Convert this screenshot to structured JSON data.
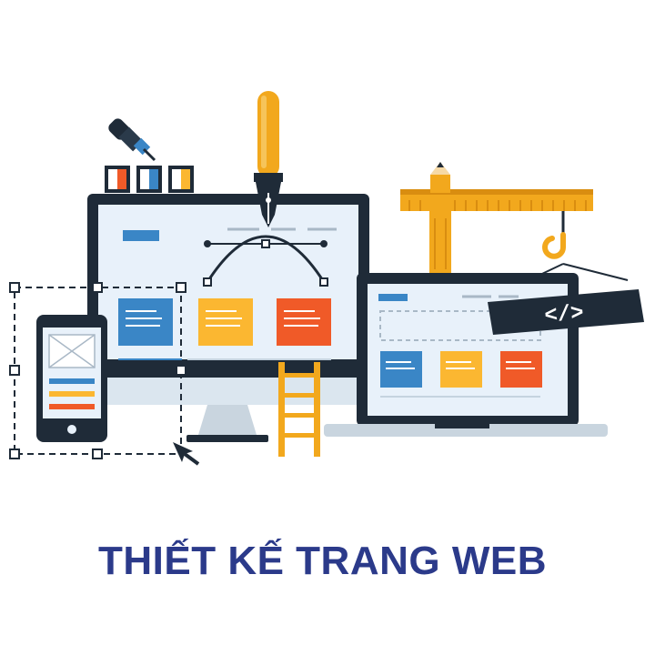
{
  "caption": "THIẾT KẾ TRANG WEB",
  "code_sign": "</>",
  "colors": {
    "navy": "#1f2b38",
    "screen": "#e8f1fa",
    "blue_card": "#3a86c6",
    "yellow_card": "#fbb731",
    "orange_card": "#f05a28",
    "gold": "#f2a81d",
    "caption": "#2b3a8a"
  },
  "icons": [
    "eyedropper-icon",
    "paint-pot-icon",
    "pen-nib-icon",
    "pencil-icon",
    "crane-hook-icon",
    "ladder-icon",
    "cursor-icon",
    "code-icon"
  ]
}
